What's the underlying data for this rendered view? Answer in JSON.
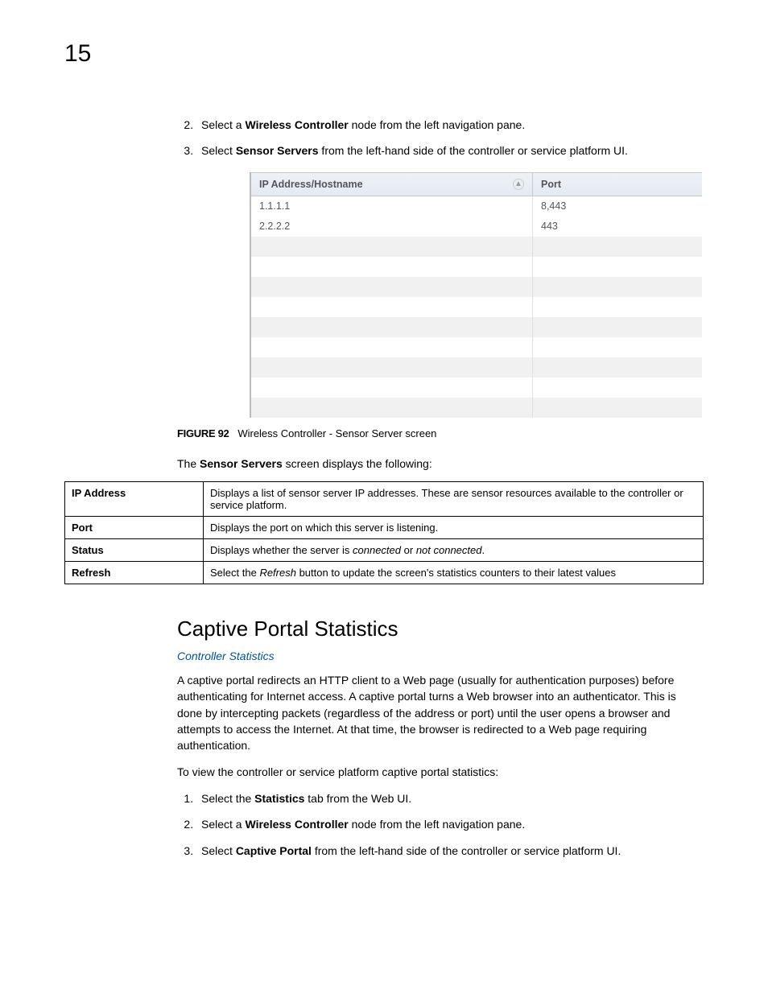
{
  "page_number": "15",
  "steps_top": [
    {
      "num": "2.",
      "pre": "Select a ",
      "bold": "Wireless Controller",
      "post": " node from the left navigation pane."
    },
    {
      "num": "3.",
      "pre": "Select ",
      "bold": "Sensor Servers",
      "post": " from the left-hand side of the controller or service platform UI."
    }
  ],
  "ui_table": {
    "header_ip": "IP Address/Hostname",
    "header_port": "Port",
    "rows": [
      {
        "ip": "1.1.1.1",
        "port": "8,443"
      },
      {
        "ip": "2.2.2.2",
        "port": "443"
      },
      {
        "ip": "",
        "port": ""
      },
      {
        "ip": "",
        "port": ""
      },
      {
        "ip": "",
        "port": ""
      },
      {
        "ip": "",
        "port": ""
      },
      {
        "ip": "",
        "port": ""
      },
      {
        "ip": "",
        "port": ""
      },
      {
        "ip": "",
        "port": ""
      },
      {
        "ip": "",
        "port": ""
      },
      {
        "ip": "",
        "port": ""
      }
    ]
  },
  "figure": {
    "label": "FIGURE 92",
    "caption": "Wireless Controller - Sensor Server screen"
  },
  "intro_para": {
    "pre": "The ",
    "bold": "Sensor Servers",
    "post": " screen displays the following:"
  },
  "definitions": [
    {
      "term": "IP Address",
      "desc": "Displays a list of sensor server IP addresses. These are sensor resources available to the controller or service platform."
    },
    {
      "term": "Port",
      "desc": "Displays the port on which this server is listening."
    },
    {
      "term": "Status",
      "desc_pre": "Displays whether the server is ",
      "em1": "connected",
      "mid": " or ",
      "em2": "not connected",
      "desc_post": "."
    },
    {
      "term": "Refresh",
      "desc_pre": "Select the ",
      "em1": "Refresh",
      "mid": " button to update the screen's statistics counters to their latest values",
      "em2": "",
      "desc_post": ""
    }
  ],
  "section_heading": "Captive Portal Statistics",
  "section_link": "Controller Statistics",
  "section_para": "A captive portal redirects an HTTP client to a Web page (usually for authentication purposes) before authenticating for Internet access. A captive portal turns a Web browser into an authenticator. This is done by intercepting packets (regardless of the address or port) until the user opens a browser and attempts to access the Internet. At that time, the browser is redirected to a Web page requiring authentication.",
  "section_para2": "To view the controller or service platform captive portal statistics:",
  "steps_bottom": [
    {
      "num": "1.",
      "pre": "Select the ",
      "bold": "Statistics",
      "post": " tab from the Web UI."
    },
    {
      "num": "2.",
      "pre": "Select a ",
      "bold": "Wireless Controller",
      "post": " node from the left navigation pane."
    },
    {
      "num": "3.",
      "pre": "Select ",
      "bold": "Captive Portal",
      "post": " from the left-hand side of the controller or service platform UI."
    }
  ]
}
